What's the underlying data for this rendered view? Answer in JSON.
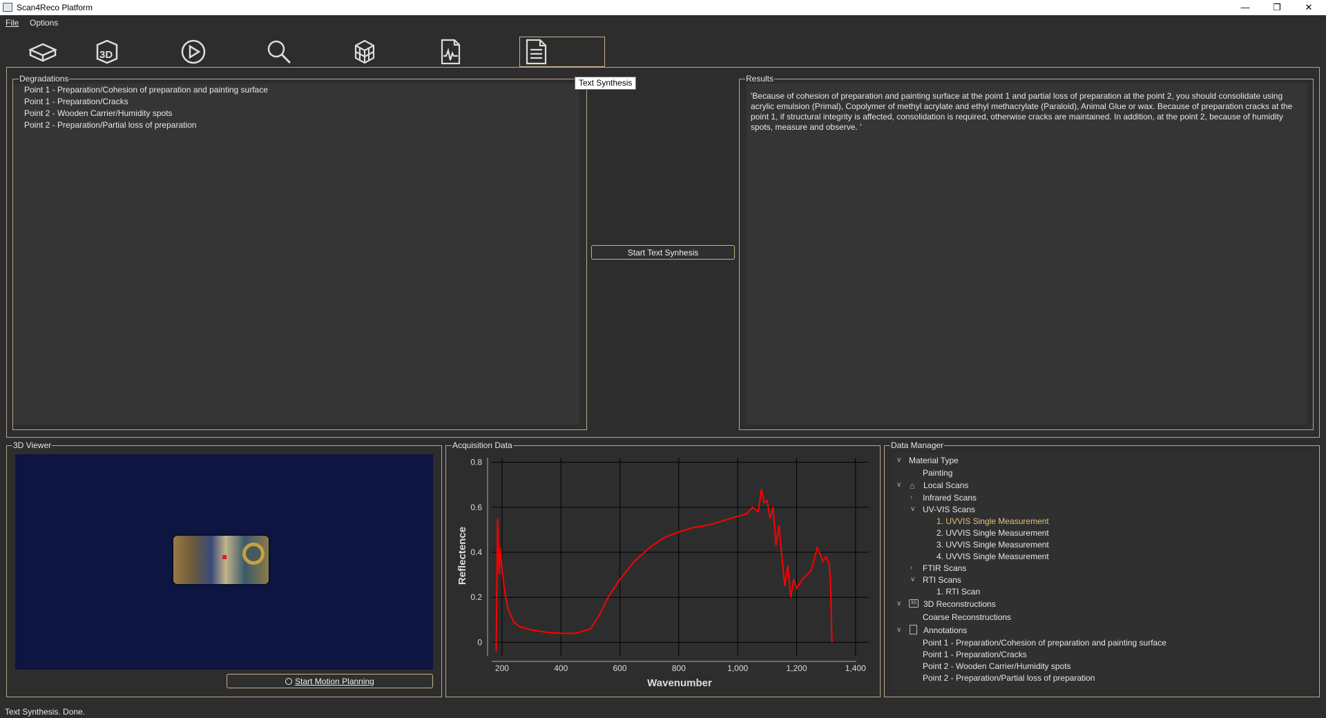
{
  "window": {
    "title": "Scan4Reco Platform"
  },
  "menu": {
    "file": "File",
    "options": "Options"
  },
  "toolbar": {
    "icons": [
      "box-icon",
      "3d-icon",
      "play-circle-icon",
      "search-icon",
      "cube-grid-icon",
      "chart-document-icon",
      "text-document-icon"
    ]
  },
  "tooltip": "Text Synthesis",
  "degradations": {
    "label": "Degradations",
    "items": [
      "Point 1 - Preparation/Cohesion of preparation and painting surface",
      "Point 1 - Preparation/Cracks",
      "Point 2 - Wooden Carrier/Humidity spots",
      "Point 2 - Preparation/Partial loss of preparation"
    ]
  },
  "start_text_button": "Start Text Synhesis",
  "results": {
    "label": "Results",
    "text": "'Because of cohesion of preparation and painting surface at the point 1 and partial loss of preparation at the point 2, you should consolidate using acrylic emulsion (Primal), Copolymer of methyl acrylate and ethyl methacrylate (Paraloid), Animal Glue or wax. Because of preparation cracks at the point 1, if structural integrity is affected, consolidation is required, otherwise cracks are maintained. In addition, at the point 2, because of humidity spots, measure and observe. '"
  },
  "viewer": {
    "label": "3D Viewer",
    "button": "Start Motion Planning"
  },
  "acquisition": {
    "label": "Acquisition Data"
  },
  "chart_data": {
    "type": "line",
    "xlabel": "Wavenumber",
    "ylabel": "Reflectence",
    "xlim": [
      165,
      1445
    ],
    "ylim": [
      -0.06,
      0.82
    ],
    "xticks": [
      "200",
      "400",
      "600",
      "800",
      "1,000",
      "1,200",
      "1,400"
    ],
    "yticks": [
      "0",
      "0.2",
      "0.4",
      "0.6",
      "0.8"
    ],
    "grid": true,
    "color": "#ff0000",
    "series": [
      {
        "x": [
          180,
          185,
          190,
          195,
          200,
          210,
          220,
          240,
          260,
          300,
          350,
          400,
          450,
          500,
          530,
          560,
          600,
          650,
          700,
          750,
          800,
          850,
          900,
          950,
          1000,
          1030,
          1050,
          1070,
          1080,
          1090,
          1100,
          1110,
          1120,
          1130,
          1140,
          1150,
          1160,
          1170,
          1180,
          1190,
          1200,
          1220,
          1250,
          1270,
          1290,
          1300,
          1310,
          1315,
          1320
        ],
        "y": [
          -0.04,
          0.55,
          0.3,
          0.42,
          0.32,
          0.22,
          0.15,
          0.09,
          0.07,
          0.055,
          0.045,
          0.04,
          0.04,
          0.06,
          0.12,
          0.2,
          0.28,
          0.36,
          0.42,
          0.465,
          0.49,
          0.51,
          0.52,
          0.54,
          0.56,
          0.57,
          0.6,
          0.58,
          0.68,
          0.62,
          0.63,
          0.55,
          0.6,
          0.43,
          0.52,
          0.38,
          0.25,
          0.34,
          0.2,
          0.28,
          0.24,
          0.28,
          0.32,
          0.42,
          0.36,
          0.38,
          0.35,
          0.28,
          0.0
        ]
      }
    ]
  },
  "data_manager": {
    "label": "Data Manager",
    "material_type": "Material Type",
    "painting": "Painting",
    "local_scans": "Local Scans",
    "infrared": "Infrared Scans",
    "uvvis": "UV-VIS Scans",
    "uvvis_items": [
      "1. UVVIS Single Measurement",
      "2. UVVIS Single Measurement",
      "3. UVVIS Single Measurement",
      "4. UVVIS Single Measurement"
    ],
    "ftir": "FTIR Scans",
    "rti": "RTI Scans",
    "rti_item": "1. RTI Scan",
    "recon": "3D Reconstructions",
    "coarse": "Coarse Reconstructions",
    "annotations": "Annotations",
    "annotation_items": [
      "Point 1 - Preparation/Cohesion of preparation and painting surface",
      "Point 1 - Preparation/Cracks",
      "Point 2 - Wooden Carrier/Humidity spots",
      "Point 2 - Preparation/Partial loss of preparation"
    ]
  },
  "status": "Text Synthesis. Done."
}
